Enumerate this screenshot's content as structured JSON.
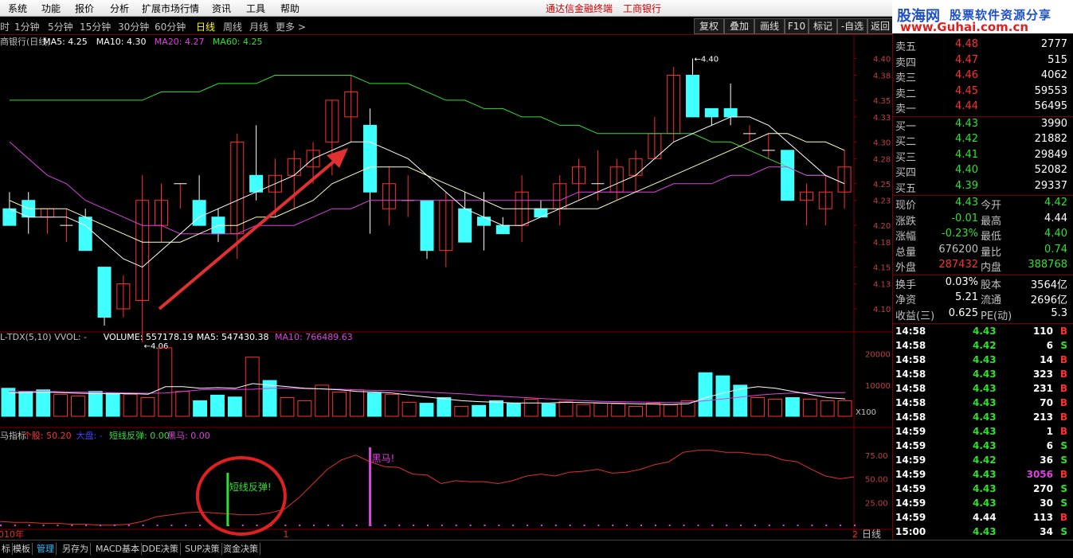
{
  "menu": [
    "系统",
    "功能",
    "报价",
    "分析",
    "扩展市场行情",
    "资讯",
    "工具",
    "帮助"
  ],
  "window_title": "通达信金融终端",
  "window_stock": "工商银行",
  "periods": [
    "时",
    "1分钟",
    "5分钟",
    "15分钟",
    "30分钟",
    "60分钟",
    "日线",
    "周线",
    "月线",
    "更多 >"
  ],
  "active_period": "日线",
  "tool_buttons": [
    "复权",
    "叠加",
    "画线",
    "F10",
    "标记",
    "-自选",
    "返回"
  ],
  "logo": {
    "name": "股海网",
    "slogan": "股票软件资源分享",
    "url": "www.Guhai.com.cn"
  },
  "main_legend": [
    {
      "text": "商银行(日线)",
      "color": "#c0c0c0"
    },
    {
      "text": "MA5: 4.25",
      "color": "#ffffff"
    },
    {
      "text": "MA10: 4.30",
      "color": "#ffffff"
    },
    {
      "text": "MA20: 4.27",
      "color": "#e040e0"
    },
    {
      "text": "MA60: 4.25",
      "color": "#30e030"
    }
  ],
  "vol_legend": [
    {
      "text": "L-TDX(5,10) VVOL: -",
      "color": "#c0c0c0"
    },
    {
      "text": "VOLUME: 557178.19",
      "color": "#ffffff"
    },
    {
      "text": "MA5: 547430.38",
      "color": "#ffffff"
    },
    {
      "text": "MA10: 766489.63",
      "color": "#e040e0"
    }
  ],
  "ind_legend": [
    {
      "text": "马指标",
      "color": "#c0c0c0"
    },
    {
      "text": "个股: 50.20",
      "color": "#ff3030"
    },
    {
      "text": "大盘: -",
      "color": "#4040ff"
    },
    {
      "text": "短线反弹: 0.00",
      "color": "#30e030"
    },
    {
      "text": "黑马: 0.00",
      "color": "#e040e0"
    }
  ],
  "annotations": {
    "high": "4.40",
    "low": "4.06",
    "rebound": "短线反弹!",
    "darkhorse": "黑马!",
    "vol_mult": "X100"
  },
  "colors": {
    "up": "#ff3030",
    "down": "#40ffff",
    "ma5": "#ffffff",
    "ma10": "#ffffc0",
    "ma20": "#e040e0",
    "ma60": "#30e030",
    "grid": "#7a0000",
    "arrow": "#e03030"
  },
  "chart_data": [
    {
      "type": "candlestick",
      "y_ticks": [
        "4.40",
        "4.38",
        "4.35",
        "4.33",
        "4.30",
        "4.28",
        "4.25",
        "4.23",
        "4.20",
        "4.18",
        "4.15",
        "4.13",
        "4.10"
      ],
      "ylim": [
        4.08,
        4.41
      ],
      "candles": [
        {
          "o": 4.22,
          "h": 4.24,
          "l": 4.2,
          "c": 4.2
        },
        {
          "o": 4.23,
          "h": 4.24,
          "l": 4.19,
          "c": 4.21
        },
        {
          "o": 4.21,
          "h": 4.22,
          "l": 4.19,
          "c": 4.22
        },
        {
          "o": 4.2,
          "h": 4.22,
          "l": 4.18,
          "c": 4.2
        },
        {
          "o": 4.21,
          "h": 4.22,
          "l": 4.17,
          "c": 4.17
        },
        {
          "o": 4.15,
          "h": 4.15,
          "l": 4.08,
          "c": 4.09
        },
        {
          "o": 4.1,
          "h": 4.14,
          "l": 4.09,
          "c": 4.13
        },
        {
          "o": 4.11,
          "h": 4.26,
          "l": 4.06,
          "c": 4.23
        },
        {
          "o": 4.2,
          "h": 4.25,
          "l": 4.18,
          "c": 4.23
        },
        {
          "o": 4.25,
          "h": 4.25,
          "l": 4.22,
          "c": 4.25
        },
        {
          "o": 4.23,
          "h": 4.26,
          "l": 4.2,
          "c": 4.2
        },
        {
          "o": 4.21,
          "h": 4.22,
          "l": 4.18,
          "c": 4.19
        },
        {
          "o": 4.19,
          "h": 4.31,
          "l": 4.16,
          "c": 4.3
        },
        {
          "o": 4.26,
          "h": 4.32,
          "l": 4.23,
          "c": 4.24
        },
        {
          "o": 4.24,
          "h": 4.28,
          "l": 4.21,
          "c": 4.26
        },
        {
          "o": 4.26,
          "h": 4.29,
          "l": 4.22,
          "c": 4.28
        },
        {
          "o": 4.27,
          "h": 4.3,
          "l": 4.25,
          "c": 4.29
        },
        {
          "o": 4.3,
          "h": 4.35,
          "l": 4.26,
          "c": 4.35
        },
        {
          "o": 4.33,
          "h": 4.38,
          "l": 4.3,
          "c": 4.36
        },
        {
          "o": 4.32,
          "h": 4.34,
          "l": 4.19,
          "c": 4.24
        },
        {
          "o": 4.22,
          "h": 4.27,
          "l": 4.2,
          "c": 4.25
        },
        {
          "o": 4.23,
          "h": 4.26,
          "l": 4.21,
          "c": 4.23
        },
        {
          "o": 4.23,
          "h": 4.23,
          "l": 4.16,
          "c": 4.17
        },
        {
          "o": 4.17,
          "h": 4.24,
          "l": 4.15,
          "c": 4.23
        },
        {
          "o": 4.22,
          "h": 4.24,
          "l": 4.18,
          "c": 4.18
        },
        {
          "o": 4.21,
          "h": 4.24,
          "l": 4.17,
          "c": 4.2
        },
        {
          "o": 4.2,
          "h": 4.21,
          "l": 4.19,
          "c": 4.19
        },
        {
          "o": 4.2,
          "h": 4.26,
          "l": 4.18,
          "c": 4.24
        },
        {
          "o": 4.22,
          "h": 4.23,
          "l": 4.21,
          "c": 4.21
        },
        {
          "o": 4.22,
          "h": 4.26,
          "l": 4.2,
          "c": 4.25
        },
        {
          "o": 4.25,
          "h": 4.28,
          "l": 4.23,
          "c": 4.27
        },
        {
          "o": 4.25,
          "h": 4.29,
          "l": 4.23,
          "c": 4.25
        },
        {
          "o": 4.24,
          "h": 4.28,
          "l": 4.23,
          "c": 4.27
        },
        {
          "o": 4.26,
          "h": 4.29,
          "l": 4.24,
          "c": 4.28
        },
        {
          "o": 4.28,
          "h": 4.33,
          "l": 4.28,
          "c": 4.31
        },
        {
          "o": 4.31,
          "h": 4.39,
          "l": 4.3,
          "c": 4.38
        },
        {
          "o": 4.38,
          "h": 4.4,
          "l": 4.34,
          "c": 4.33
        },
        {
          "o": 4.34,
          "h": 4.34,
          "l": 4.32,
          "c": 4.33
        },
        {
          "o": 4.34,
          "h": 4.37,
          "l": 4.32,
          "c": 4.33
        },
        {
          "o": 4.31,
          "h": 4.32,
          "l": 4.3,
          "c": 4.31
        },
        {
          "o": 4.29,
          "h": 4.31,
          "l": 4.28,
          "c": 4.29
        },
        {
          "o": 4.29,
          "h": 4.29,
          "l": 4.23,
          "c": 4.23
        },
        {
          "o": 4.23,
          "h": 4.25,
          "l": 4.2,
          "c": 4.24
        },
        {
          "o": 4.22,
          "h": 4.26,
          "l": 4.2,
          "c": 4.24
        },
        {
          "o": 4.24,
          "h": 4.29,
          "l": 4.22,
          "c": 4.27
        }
      ],
      "ma5": [
        4.22,
        4.21,
        4.21,
        4.21,
        4.2,
        4.18,
        4.16,
        4.15,
        4.17,
        4.19,
        4.21,
        4.22,
        4.23,
        4.24,
        4.25,
        4.26,
        4.28,
        4.29,
        4.3,
        4.3,
        4.29,
        4.28,
        4.26,
        4.24,
        4.22,
        4.21,
        4.2,
        4.2,
        4.21,
        4.22,
        4.23,
        4.24,
        4.25,
        4.26,
        4.28,
        4.3,
        4.31,
        4.32,
        4.33,
        4.33,
        4.32,
        4.3,
        4.28,
        4.26,
        4.25
      ],
      "ma10": [
        4.23,
        4.22,
        4.22,
        4.22,
        4.21,
        4.2,
        4.19,
        4.18,
        4.18,
        4.18,
        4.19,
        4.2,
        4.2,
        4.21,
        4.21,
        4.22,
        4.23,
        4.25,
        4.26,
        4.27,
        4.27,
        4.27,
        4.26,
        4.25,
        4.24,
        4.23,
        4.22,
        4.22,
        4.22,
        4.22,
        4.22,
        4.22,
        4.23,
        4.24,
        4.25,
        4.26,
        4.27,
        4.28,
        4.29,
        4.3,
        4.31,
        4.31,
        4.3,
        4.3,
        4.29
      ],
      "ma20": [
        4.3,
        4.28,
        4.26,
        4.25,
        4.23,
        4.22,
        4.21,
        4.2,
        4.2,
        4.19,
        4.19,
        4.19,
        4.19,
        4.2,
        4.2,
        4.2,
        4.21,
        4.22,
        4.22,
        4.23,
        4.23,
        4.23,
        4.23,
        4.23,
        4.23,
        4.23,
        4.23,
        4.23,
        4.23,
        4.23,
        4.24,
        4.24,
        4.24,
        4.24,
        4.24,
        4.25,
        4.25,
        4.25,
        4.26,
        4.26,
        4.27,
        4.27,
        4.26,
        4.26,
        4.25
      ],
      "ma60": [
        4.35,
        4.35,
        4.35,
        4.35,
        4.35,
        4.35,
        4.35,
        4.35,
        4.36,
        4.36,
        4.36,
        4.37,
        4.37,
        4.37,
        4.38,
        4.38,
        4.38,
        4.38,
        4.38,
        4.37,
        4.37,
        4.37,
        4.36,
        4.35,
        4.35,
        4.34,
        4.34,
        4.33,
        4.33,
        4.32,
        4.32,
        4.31,
        4.31,
        4.31,
        4.31,
        4.31,
        4.31,
        4.3,
        4.3,
        4.29,
        4.28,
        4.27,
        4.26,
        4.26,
        4.25
      ]
    },
    {
      "type": "bar",
      "y_ticks": [
        "20000",
        "10000"
      ],
      "ylim": [
        0,
        23000
      ],
      "volumes": [
        9000,
        8000,
        8500,
        7000,
        6500,
        8000,
        7500,
        7000,
        6000,
        22000,
        8000,
        5000,
        6800,
        6200,
        19000,
        11500,
        6000,
        5000,
        10000,
        7800,
        8500,
        7500,
        7000,
        4500,
        4200,
        6000,
        3200,
        3500,
        5000,
        4200,
        5500,
        4000,
        4800,
        3800,
        4200,
        4000,
        3200,
        4200,
        3700,
        5000,
        14000,
        13000,
        10000,
        6000,
        5500,
        6000,
        5500,
        5000,
        5000
      ],
      "ma5": [
        7500,
        7600,
        7800,
        7600,
        7400,
        7300,
        7200,
        7300,
        7100,
        9500,
        9500,
        9000,
        9200,
        9000,
        10500,
        10000,
        9500,
        9000,
        8800,
        8500,
        8000,
        7800,
        7500,
        6800,
        6200,
        5600,
        5000,
        4700,
        4500,
        4300,
        4300,
        4300,
        4500,
        4400,
        4300,
        4200,
        4000,
        3900,
        3800,
        4000,
        6000,
        7500,
        8800,
        9500,
        9000,
        8000,
        7000,
        6000,
        5600
      ],
      "ma10": [
        8000,
        8000,
        8000,
        7900,
        7800,
        7700,
        7600,
        7500,
        7400,
        7500,
        8000,
        8500,
        8600,
        8600,
        8700,
        9000,
        9000,
        8900,
        8800,
        8700,
        8500,
        8300,
        8200,
        8000,
        7800,
        7500,
        7200,
        6800,
        6500,
        6200,
        5900,
        5600,
        5300,
        5000,
        4800,
        4700,
        4600,
        4500,
        4400,
        4500,
        5000,
        5600,
        6200,
        6800,
        7200,
        7500,
        7600,
        7600,
        7600
      ]
    },
    {
      "type": "line",
      "y_ticks": [
        "75.00",
        "50.00",
        "25.00"
      ],
      "ylim": [
        0,
        95
      ],
      "series": [
        {
          "name": "个股",
          "values": [
            5,
            4,
            4,
            3,
            3,
            2,
            2,
            1,
            1,
            2,
            5,
            10,
            12,
            14,
            15,
            14,
            13,
            12,
            12,
            14,
            18,
            30,
            45,
            60,
            70,
            75,
            68,
            63,
            62,
            55,
            54,
            45,
            48,
            47,
            47,
            45,
            48,
            53,
            55,
            53,
            57,
            58,
            60,
            56,
            57,
            60,
            65,
            68,
            78,
            80,
            80,
            78,
            78,
            76,
            75,
            70,
            68,
            60,
            53,
            50,
            52
          ]
        }
      ],
      "rebound_index": 16,
      "darkhorse_index": 26
    }
  ],
  "x_labels": [
    {
      "text": "010年",
      "i": 0
    },
    {
      "text": "1",
      "i": 10
    },
    {
      "text": "2",
      "i": 30
    }
  ],
  "x_axis_right": "日线",
  "order_book": {
    "sell": [
      {
        "label": "卖五",
        "price": "4.48",
        "vol": "2777"
      },
      {
        "label": "卖四",
        "price": "4.47",
        "vol": "515"
      },
      {
        "label": "卖三",
        "price": "4.46",
        "vol": "4062"
      },
      {
        "label": "卖二",
        "price": "4.45",
        "vol": "59553"
      },
      {
        "label": "卖一",
        "price": "4.44",
        "vol": "56495"
      }
    ],
    "buy": [
      {
        "label": "买一",
        "price": "4.43",
        "vol": "3990"
      },
      {
        "label": "买二",
        "price": "4.42",
        "vol": "21882"
      },
      {
        "label": "买三",
        "price": "4.41",
        "vol": "29849"
      },
      {
        "label": "买四",
        "price": "4.40",
        "vol": "52082"
      },
      {
        "label": "买五",
        "price": "4.39",
        "vol": "29337"
      }
    ]
  },
  "quote": [
    {
      "l1": "现价",
      "v1": "4.43",
      "c1": "green",
      "l2": "今开",
      "v2": "4.42",
      "c2": "green"
    },
    {
      "l1": "涨跌",
      "v1": "-0.01",
      "c1": "green",
      "l2": "最高",
      "v2": "4.44",
      "c2": "white"
    },
    {
      "l1": "涨幅",
      "v1": "-0.23%",
      "c1": "green",
      "l2": "最低",
      "v2": "4.40",
      "c2": "green"
    },
    {
      "l1": "总量",
      "v1": "676200",
      "c1": "grey",
      "l2": "量比",
      "v2": "0.74",
      "c2": "green"
    },
    {
      "l1": "外盘",
      "v1": "287432",
      "c1": "red",
      "l2": "内盘",
      "v2": "388768",
      "c2": "green"
    }
  ],
  "stats": [
    {
      "l1": "换手",
      "v1": "0.03%",
      "l2": "股本",
      "v2": "3564亿"
    },
    {
      "l1": "净资",
      "v1": "5.21",
      "l2": "流通",
      "v2": "2696亿"
    },
    {
      "l1": "收益(三)",
      "v1": "0.625",
      "l2": "PE(动)",
      "v2": "5.3"
    }
  ],
  "ticks": [
    {
      "t": "14:58",
      "p": "4.43",
      "v": "110",
      "s": "B"
    },
    {
      "t": "14:58",
      "p": "4.42",
      "v": "6",
      "s": "S"
    },
    {
      "t": "14:58",
      "p": "4.43",
      "v": "14",
      "s": "B"
    },
    {
      "t": "14:58",
      "p": "4.43",
      "v": "323",
      "s": "B"
    },
    {
      "t": "14:58",
      "p": "4.43",
      "v": "231",
      "s": "B"
    },
    {
      "t": "14:58",
      "p": "4.43",
      "v": "70",
      "s": "B"
    },
    {
      "t": "14:58",
      "p": "4.43",
      "v": "213",
      "s": "B"
    },
    {
      "t": "14:59",
      "p": "4.43",
      "v": "1",
      "s": "B"
    },
    {
      "t": "14:59",
      "p": "4.43",
      "v": "6",
      "s": "S"
    },
    {
      "t": "14:59",
      "p": "4.42",
      "v": "36",
      "s": "S"
    },
    {
      "t": "14:59",
      "p": "4.43",
      "v": "3056",
      "s": "B"
    },
    {
      "t": "14:59",
      "p": "4.43",
      "v": "270",
      "s": "S"
    },
    {
      "t": "14:59",
      "p": "4.43",
      "v": "30",
      "s": "S"
    },
    {
      "t": "14:59",
      "p": "4.44",
      "v": "113",
      "s": "B"
    },
    {
      "t": "15:00",
      "p": "4.43",
      "v": "34",
      "s": "S"
    }
  ],
  "bottom_tabs": [
    "标",
    "模板",
    "管理",
    "另存为",
    "MACD基本",
    "DDE决策",
    "SUP决策",
    "资金决策"
  ],
  "active_bottom_tab": "管理"
}
